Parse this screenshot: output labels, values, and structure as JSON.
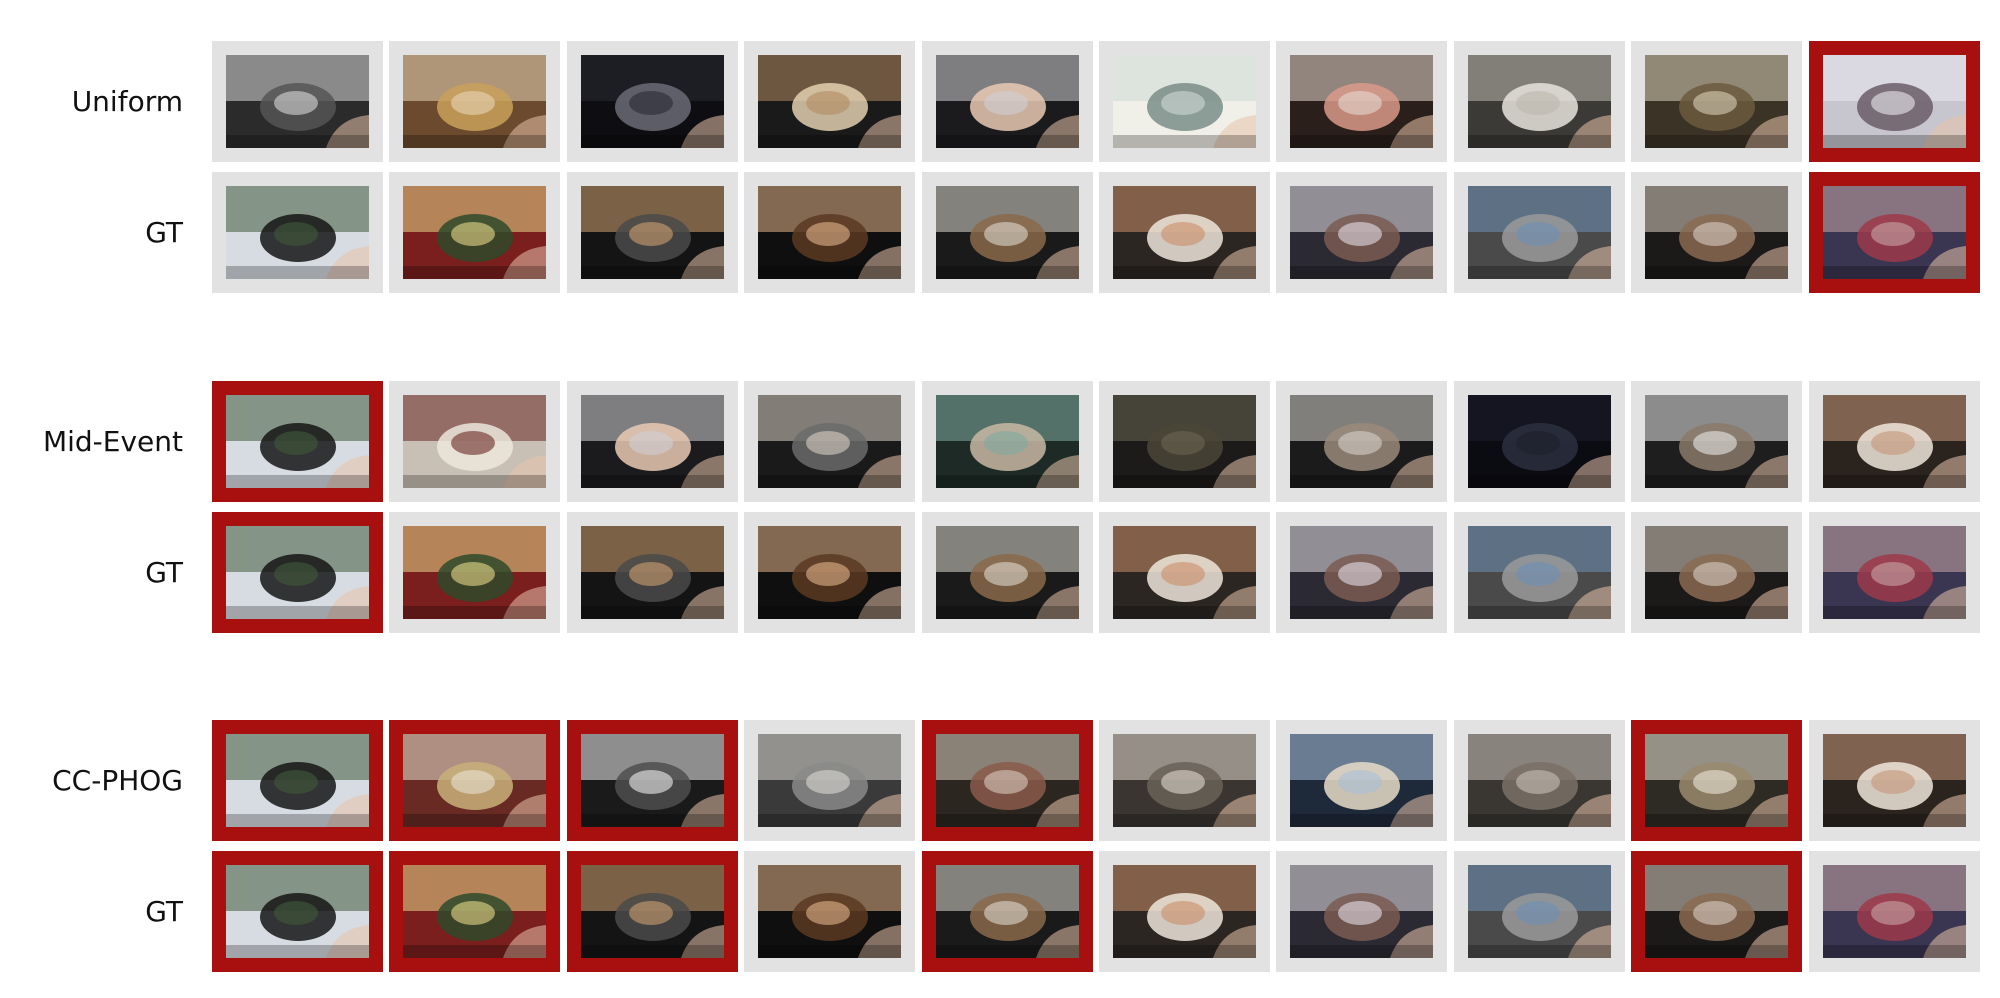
{
  "figure": {
    "groups": [
      {
        "rows": [
          {
            "label": "Uniform",
            "selected": [
              false,
              false,
              false,
              false,
              false,
              false,
              false,
              false,
              false,
              true
            ],
            "scenes": [
              "steering-wheel",
              "grocery-pastry",
              "car-interior-dark",
              "mixing-bowl-spoon",
              "tablet-hand",
              "bright-kitchen-blur",
              "counter-hand",
              "sink-stove",
              "pan-cooking",
              "living-room-person"
            ]
          },
          {
            "label": "GT",
            "selected": [
              false,
              false,
              false,
              false,
              false,
              false,
              false,
              false,
              false,
              true
            ],
            "scenes": [
              "road-drive",
              "grocery-shelf-bottle",
              "tablet-bowl",
              "bowl-chips",
              "tray-tablet",
              "cutting-board",
              "bowl-pot",
              "sink-gloves",
              "pan-stirfry",
              "person-eating"
            ]
          }
        ]
      },
      {
        "rows": [
          {
            "label": "Mid-Event",
            "selected": [
              true,
              false,
              false,
              false,
              false,
              false,
              false,
              false,
              false,
              false
            ],
            "scenes": [
              "road-drive",
              "grocery-aisle",
              "tablet-hand",
              "counter-hands",
              "green-bowl",
              "tray-cookies-dark",
              "counter-kettle",
              "dark-room",
              "rice-cooker",
              "bowl-food"
            ]
          },
          {
            "label": "GT",
            "selected": [
              true,
              false,
              false,
              false,
              false,
              false,
              false,
              false,
              false,
              false
            ],
            "scenes": [
              "road-drive",
              "grocery-shelf-bottle",
              "tablet-bowl",
              "bowl-chips",
              "tray-tablet",
              "cutting-board",
              "bowl-pot",
              "sink-gloves",
              "pan-stirfry",
              "person-eating"
            ]
          }
        ]
      },
      {
        "rows": [
          {
            "label": "CC-PHOG",
            "selected": [
              true,
              true,
              true,
              false,
              true,
              false,
              false,
              false,
              true,
              false
            ],
            "scenes": [
              "road-drive",
              "grocery-box",
              "coffee-machine",
              "counter-wide",
              "tray-blur",
              "kitchen-blur",
              "window-tray",
              "sink-wide",
              "plate-blur",
              "bowl-food"
            ]
          },
          {
            "label": "GT",
            "selected": [
              true,
              true,
              true,
              false,
              true,
              false,
              false,
              false,
              true,
              false
            ],
            "scenes": [
              "road-drive",
              "grocery-shelf-bottle",
              "tablet-bowl",
              "bowl-chips",
              "tray-tablet",
              "cutting-board",
              "bowl-pot",
              "sink-gloves",
              "pan-stirfry",
              "person-eating"
            ]
          }
        ]
      }
    ]
  }
}
